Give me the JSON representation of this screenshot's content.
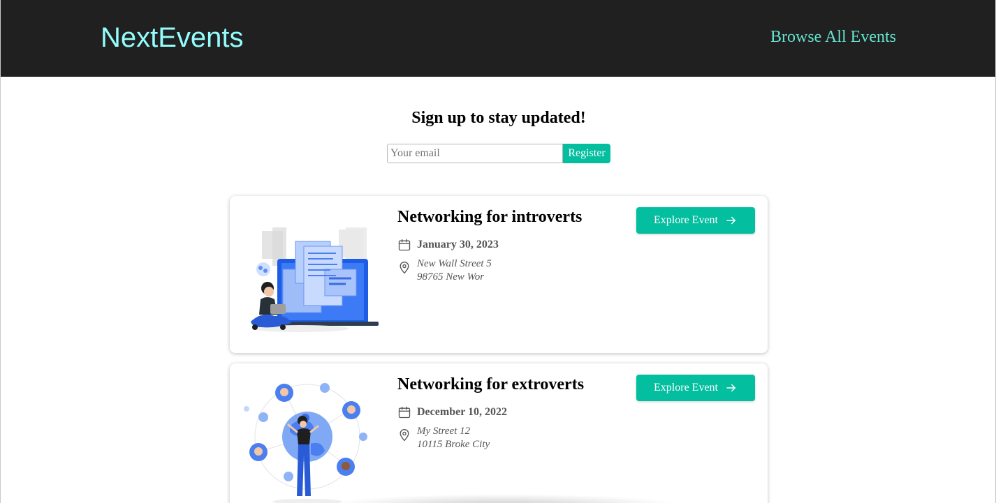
{
  "header": {
    "logo": "NextEvents",
    "nav_link": "Browse All Events"
  },
  "signup": {
    "title": "Sign up to stay updated!",
    "email_placeholder": "Your email",
    "register_label": "Register"
  },
  "events": [
    {
      "title": "Networking for introverts",
      "date": "January 30, 2023",
      "address_line1": "New Wall Street 5",
      "address_line2": "98765 New Wor",
      "button_label": "Explore Event",
      "image_icon": "remote-work-illustration"
    },
    {
      "title": "Networking for extroverts",
      "date": "December 10, 2022",
      "address_line1": "My Street 12",
      "address_line2": "10115 Broke City",
      "button_label": "Explore Event",
      "image_icon": "global-network-illustration"
    }
  ],
  "colors": {
    "header_bg": "#202020",
    "logo": "#94fdfd",
    "nav_link": "#64e4cf",
    "accent": "#03be9f"
  }
}
